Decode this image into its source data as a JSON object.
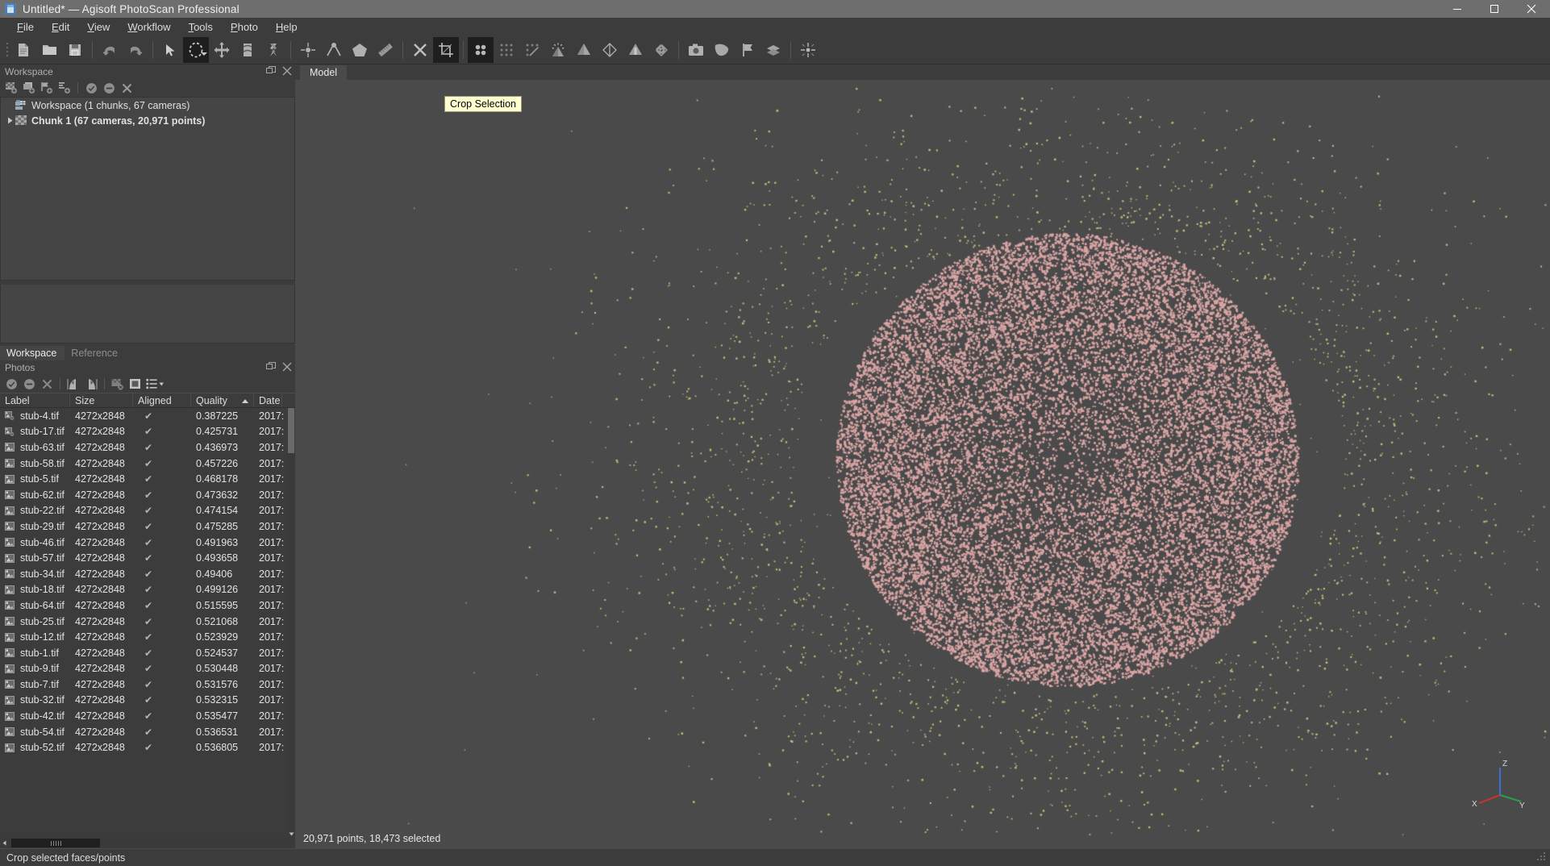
{
  "window": {
    "title": "Untitled* — Agisoft PhotoScan Professional",
    "icon": "photoscan-app-icon",
    "controls": {
      "minimize": "—",
      "maximize": "❐",
      "close": "✕"
    }
  },
  "menubar": {
    "items": [
      {
        "label": "File",
        "accel": "F"
      },
      {
        "label": "Edit",
        "accel": "E"
      },
      {
        "label": "View",
        "accel": "V"
      },
      {
        "label": "Workflow",
        "accel": "W"
      },
      {
        "label": "Tools",
        "accel": "T"
      },
      {
        "label": "Photo",
        "accel": "P"
      },
      {
        "label": "Help",
        "accel": "H"
      }
    ]
  },
  "toolbar": {
    "groups": [
      {
        "buttons": [
          {
            "name": "new-project-icon",
            "tip": "New"
          },
          {
            "name": "open-project-icon",
            "tip": "Open"
          },
          {
            "name": "save-project-icon",
            "tip": "Save"
          }
        ]
      },
      {
        "buttons": [
          {
            "name": "undo-icon",
            "tip": "Undo"
          },
          {
            "name": "redo-icon",
            "tip": "Redo"
          }
        ]
      },
      {
        "buttons": [
          {
            "name": "navigation-arrow-icon",
            "tip": "Navigation"
          },
          {
            "name": "free-form-selection-icon",
            "tip": "Free-Form Selection",
            "active": true,
            "has_dropdown": true
          },
          {
            "name": "move-object-icon",
            "tip": "Move Object"
          },
          {
            "name": "rotate-object-icon",
            "tip": "Rotate Object"
          },
          {
            "name": "scale-object-icon",
            "tip": "Scale Object"
          }
        ]
      },
      {
        "buttons": [
          {
            "name": "place-marker-icon",
            "tip": "Place Marker"
          },
          {
            "name": "place-scalebar-icon",
            "tip": "Place Scale Bar"
          },
          {
            "name": "place-shape-icon",
            "tip": "Place Shape"
          },
          {
            "name": "ruler-icon",
            "tip": "Measure"
          }
        ]
      },
      {
        "buttons": [
          {
            "name": "delete-selection-icon",
            "tip": "Delete Selection"
          },
          {
            "name": "crop-selection-icon",
            "tip": "Crop Selection",
            "active": true
          }
        ]
      },
      {
        "buttons": [
          {
            "name": "show-cameras-icon",
            "tip": "Show Cameras",
            "active": true
          },
          {
            "name": "show-dense-cloud-icon",
            "tip": "Show Dense Cloud"
          },
          {
            "name": "show-tie-points-icon",
            "tip": "Show Tie Points"
          },
          {
            "name": "show-aligned-icon",
            "tip": "Show Aligned Photos"
          },
          {
            "name": "shaded-model-icon",
            "tip": "Shaded Model"
          },
          {
            "name": "wireframe-model-icon",
            "tip": "Wireframe Model"
          },
          {
            "name": "solid-model-icon",
            "tip": "Solid Model"
          },
          {
            "name": "textured-model-icon",
            "tip": "Textured Model"
          }
        ]
      },
      {
        "buttons": [
          {
            "name": "capture-view-icon",
            "tip": "Capture View"
          },
          {
            "name": "region-icon",
            "tip": "Resize Region"
          },
          {
            "name": "flag-icon",
            "tip": "Flag"
          },
          {
            "name": "layers-icon",
            "tip": "Layers"
          }
        ]
      },
      {
        "buttons": [
          {
            "name": "reset-view-icon",
            "tip": "Reset View"
          }
        ]
      }
    ],
    "tooltip": "Crop Selection"
  },
  "workspace_panel": {
    "title": "Workspace",
    "tools": [
      {
        "name": "add-chunk-icon"
      },
      {
        "name": "add-photos-icon"
      },
      {
        "name": "add-markers-icon"
      },
      {
        "name": "add-scalebar-icon"
      },
      {
        "name": "enable-icon"
      },
      {
        "name": "disable-icon"
      },
      {
        "name": "remove-icon"
      }
    ],
    "header_buttons": [
      {
        "name": "undock-panel-icon"
      },
      {
        "name": "close-panel-icon"
      }
    ],
    "tree": [
      {
        "label": "Workspace (1 chunks, 67 cameras)",
        "icon": "workspace-icon",
        "depth": 0,
        "bold": false,
        "expandable": false
      },
      {
        "label": "Chunk 1 (67 cameras, 20,971 points)",
        "icon": "chunk-icon",
        "depth": 1,
        "bold": true,
        "expandable": true
      }
    ],
    "tabs": [
      {
        "label": "Workspace",
        "active": true
      },
      {
        "label": "Reference",
        "active": false
      }
    ]
  },
  "photos_panel": {
    "title": "Photos",
    "header_buttons": [
      {
        "name": "undock-panel-icon"
      },
      {
        "name": "close-panel-icon"
      }
    ],
    "tools": [
      {
        "name": "enable-photos-icon"
      },
      {
        "name": "disable-photos-icon"
      },
      {
        "name": "remove-photos-icon"
      },
      {
        "name": "rotate-left-icon"
      },
      {
        "name": "rotate-right-icon"
      },
      {
        "name": "reset-masks-icon"
      },
      {
        "name": "show-masks-icon"
      },
      {
        "name": "details-view-icon",
        "has_dropdown": true
      }
    ],
    "columns": [
      {
        "key": "label",
        "title": "Label"
      },
      {
        "key": "size",
        "title": "Size"
      },
      {
        "key": "aligned",
        "title": "Aligned"
      },
      {
        "key": "quality",
        "title": "Quality",
        "sorted": "asc"
      },
      {
        "key": "date",
        "title": "Date"
      }
    ],
    "rows": [
      {
        "label": "stub-4.tif",
        "size": "4272x2848",
        "aligned": "✔",
        "quality": "0.387225",
        "date": "2017:",
        "icon": "photo-disabled-icon"
      },
      {
        "label": "stub-17.tif",
        "size": "4272x2848",
        "aligned": "✔",
        "quality": "0.425731",
        "date": "2017:",
        "icon": "photo-disabled-icon"
      },
      {
        "label": "stub-63.tif",
        "size": "4272x2848",
        "aligned": "✔",
        "quality": "0.436973",
        "date": "2017:",
        "icon": "photo-icon"
      },
      {
        "label": "stub-58.tif",
        "size": "4272x2848",
        "aligned": "✔",
        "quality": "0.457226",
        "date": "2017:",
        "icon": "photo-icon"
      },
      {
        "label": "stub-5.tif",
        "size": "4272x2848",
        "aligned": "✔",
        "quality": "0.468178",
        "date": "2017:",
        "icon": "photo-icon"
      },
      {
        "label": "stub-62.tif",
        "size": "4272x2848",
        "aligned": "✔",
        "quality": "0.473632",
        "date": "2017:",
        "icon": "photo-icon"
      },
      {
        "label": "stub-22.tif",
        "size": "4272x2848",
        "aligned": "✔",
        "quality": "0.474154",
        "date": "2017:",
        "icon": "photo-icon"
      },
      {
        "label": "stub-29.tif",
        "size": "4272x2848",
        "aligned": "✔",
        "quality": "0.475285",
        "date": "2017:",
        "icon": "photo-icon"
      },
      {
        "label": "stub-46.tif",
        "size": "4272x2848",
        "aligned": "✔",
        "quality": "0.491963",
        "date": "2017:",
        "icon": "photo-icon"
      },
      {
        "label": "stub-57.tif",
        "size": "4272x2848",
        "aligned": "✔",
        "quality": "0.493658",
        "date": "2017:",
        "icon": "photo-icon"
      },
      {
        "label": "stub-34.tif",
        "size": "4272x2848",
        "aligned": "✔",
        "quality": "0.49406",
        "date": "2017:",
        "icon": "photo-icon"
      },
      {
        "label": "stub-18.tif",
        "size": "4272x2848",
        "aligned": "✔",
        "quality": "0.499126",
        "date": "2017:",
        "icon": "photo-icon"
      },
      {
        "label": "stub-64.tif",
        "size": "4272x2848",
        "aligned": "✔",
        "quality": "0.515595",
        "date": "2017:",
        "icon": "photo-icon"
      },
      {
        "label": "stub-25.tif",
        "size": "4272x2848",
        "aligned": "✔",
        "quality": "0.521068",
        "date": "2017:",
        "icon": "photo-icon"
      },
      {
        "label": "stub-12.tif",
        "size": "4272x2848",
        "aligned": "✔",
        "quality": "0.523929",
        "date": "2017:",
        "icon": "photo-icon"
      },
      {
        "label": "stub-1.tif",
        "size": "4272x2848",
        "aligned": "✔",
        "quality": "0.524537",
        "date": "2017:",
        "icon": "photo-icon"
      },
      {
        "label": "stub-9.tif",
        "size": "4272x2848",
        "aligned": "✔",
        "quality": "0.530448",
        "date": "2017:",
        "icon": "photo-icon"
      },
      {
        "label": "stub-7.tif",
        "size": "4272x2848",
        "aligned": "✔",
        "quality": "0.531576",
        "date": "2017:",
        "icon": "photo-icon"
      },
      {
        "label": "stub-32.tif",
        "size": "4272x2848",
        "aligned": "✔",
        "quality": "0.532315",
        "date": "2017:",
        "icon": "photo-icon"
      },
      {
        "label": "stub-42.tif",
        "size": "4272x2848",
        "aligned": "✔",
        "quality": "0.535477",
        "date": "2017:",
        "icon": "photo-icon"
      },
      {
        "label": "stub-54.tif",
        "size": "4272x2848",
        "aligned": "✔",
        "quality": "0.536531",
        "date": "2017:",
        "icon": "photo-icon"
      },
      {
        "label": "stub-52.tif",
        "size": "4272x2848",
        "aligned": "✔",
        "quality": "0.536805",
        "date": "2017:",
        "icon": "photo-icon"
      }
    ]
  },
  "viewport": {
    "tab": "Model",
    "projection": "Orthographic",
    "status": "20,971 points, 18,473 selected",
    "gizmo": {
      "z": "Z",
      "x": "X",
      "y": "Y"
    },
    "point_cloud": {
      "selected_color": "#d9a4a4",
      "unselected_color": "#c8bc7a",
      "background": "#4a4a4a"
    }
  },
  "statusbar": {
    "message": "Crop selected faces/points"
  }
}
